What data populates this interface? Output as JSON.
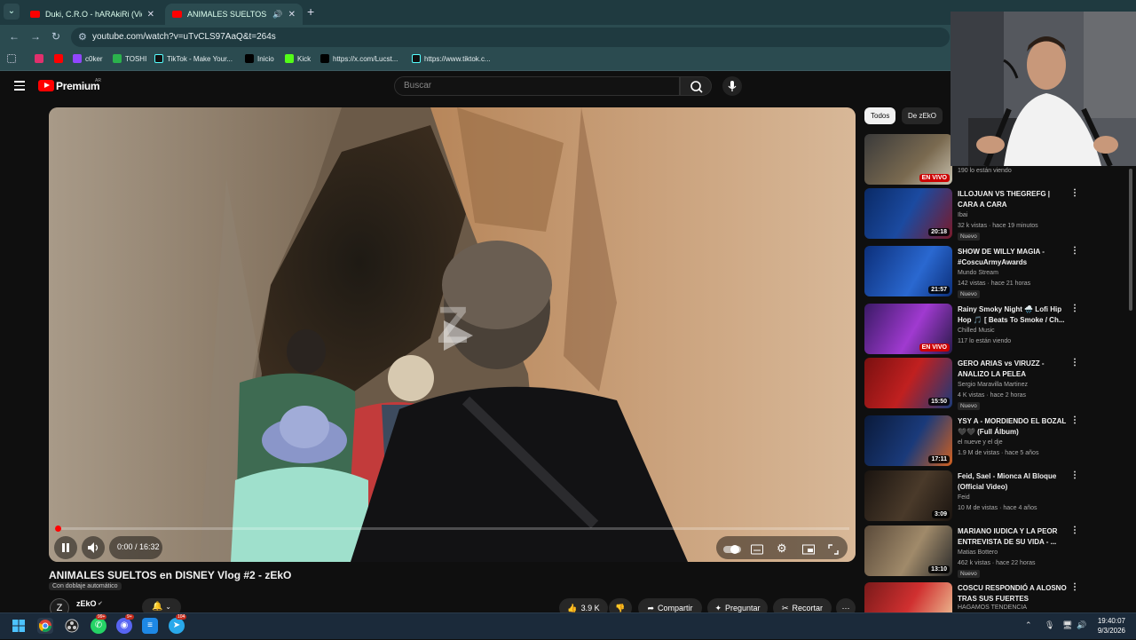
{
  "browser": {
    "tabs": [
      {
        "title": "Duki, C.R.O - hARAkiRi (Video O",
        "active": false
      },
      {
        "title": "ANIMALES SUELTOS en DIS",
        "active": true
      }
    ],
    "url": "youtube.com/watch?v=uTvCLS97AaQ&t=264s",
    "bookmarks": [
      "c0ker",
      "TOSHI",
      "TikTok - Make Your...",
      "Inicio",
      "Kick",
      "https://x.com/Lucst...",
      "https://www.tiktok.c..."
    ]
  },
  "header": {
    "brand": "Premium",
    "region": "AR",
    "search_placeholder": "Buscar"
  },
  "player": {
    "time": "0:00 / 16:32",
    "watermark": "Z",
    "progress": 0.003
  },
  "video": {
    "title": "ANIMALES SUELTOS en DISNEY Vlog #2 - zEkO",
    "dub_badge": "Con doblaje automático",
    "channel": "zEkO",
    "channel_initial": "Z",
    "likes": "3.9 K",
    "share": "Compartir",
    "ask": "Preguntar",
    "clip": "Recortar"
  },
  "chips": [
    "Todos",
    "De zEkO"
  ],
  "recommendations": [
    {
      "title": "",
      "channel": "",
      "meta": "190 lo están viendo",
      "badge": "EN VIVO",
      "nuevo": ""
    },
    {
      "title": "ILLOJUAN VS THEGREFG | CARA A CARA",
      "channel": "Ibai",
      "meta": "32 k vistas · hace 19 minutos",
      "badge": "20:18",
      "nuevo": "Nuevo"
    },
    {
      "title": "SHOW DE WILLY MAGIA - #CoscuArmyAwards",
      "channel": "Mundo Stream",
      "meta": "142 vistas · hace 21 horas",
      "badge": "21:57",
      "nuevo": "Nuevo"
    },
    {
      "title": "Rainy Smoky Night 🌧️ Lofi Hip Hop 🎵 [ Beats To Smoke / Ch...",
      "channel": "Chilled Music",
      "meta": "117 lo están viendo",
      "badge": "EN VIVO",
      "nuevo": ""
    },
    {
      "title": "GERO ARIAS vs VIRUZZ - ANALIZO LA PELEA",
      "channel": "Sergio Maravilla Martinez",
      "meta": "4 K vistas · hace 2 horas",
      "badge": "15:50",
      "nuevo": "Nuevo"
    },
    {
      "title": "YSY A - MORDIENDO EL BOZAL 🖤🖤 (Full Álbum)",
      "channel": "el nueve y el dje",
      "meta": "1.9 M de vistas · hace 5 años",
      "badge": "17:11",
      "nuevo": ""
    },
    {
      "title": "Feid, Sael - Mionca Al Bloque (Official Video)",
      "channel": "Feid",
      "meta": "10 M de vistas · hace 4 años",
      "badge": "3:09",
      "nuevo": ""
    },
    {
      "title": "MARIANO IUDICA Y LA PEOR ENTREVISTA DE SU VIDA - ...",
      "channel": "Matias Bottero",
      "meta": "462 k vistas · hace 22 horas",
      "badge": "13:10",
      "nuevo": "Nuevo"
    },
    {
      "title": "COSCU RESPONDIÓ A ALOSNO TRAS SUS FUERTES PALABRAS",
      "channel": "HAGAMOS TENDENCIA",
      "meta": "",
      "badge": "",
      "nuevo": ""
    }
  ],
  "taskbar": {
    "time": "19:40:07",
    "date": "9/3/2026",
    "badge_whatsapp": "99+",
    "badge_discord": "9+",
    "badge_telegram": "104"
  },
  "colors": {
    "background": "#0f0f0f",
    "youtube_red": "#ff0000",
    "browser_frame": "#2b4b50"
  }
}
